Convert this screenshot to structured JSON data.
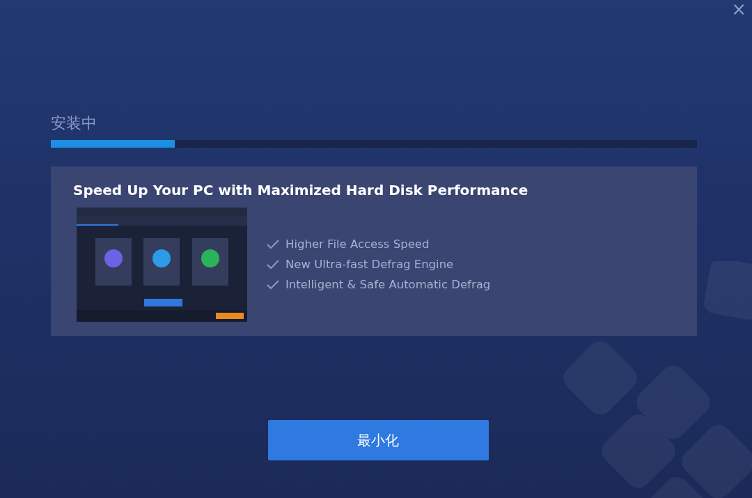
{
  "window": {
    "close": "×"
  },
  "install": {
    "status": "安装中",
    "level": 0.192
  },
  "promo": {
    "title": "Speed Up Your PC with Maximized Hard Disk Performance",
    "features": [
      {
        "text": "Higher File Access Speed"
      },
      {
        "text": "New Ultra-fast Defrag Engine"
      },
      {
        "text": "Intelligent & Safe Automatic Defrag"
      }
    ]
  },
  "buttons": [
    {
      "label": "最小化",
      "kind": "primary"
    }
  ]
}
